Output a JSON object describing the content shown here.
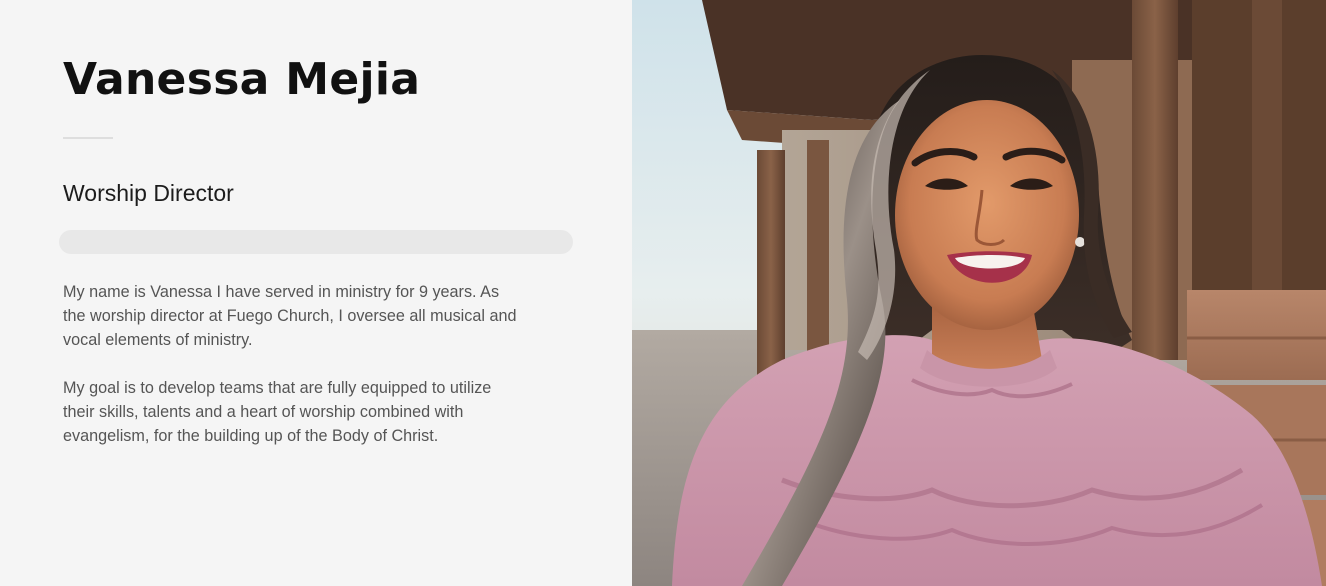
{
  "profile": {
    "name": "Vanessa Mejia",
    "role": "Worship Director",
    "bio": [
      "My name is Vanessa I have served in ministry for 9 years. As the worship director at Fuego Church, I oversee all musical and vocal elements of ministry.",
      "My goal is to develop teams that are fully equipped to utilize their skills, talents and a heart of worship combined with evangelism, for the building up of the Body of Christ."
    ]
  },
  "colors": {
    "panel_background": "#f5f5f5",
    "heading": "#111111",
    "body_text": "#555555",
    "divider": "#dedede",
    "placeholder_bar": "#e8e8e8"
  }
}
